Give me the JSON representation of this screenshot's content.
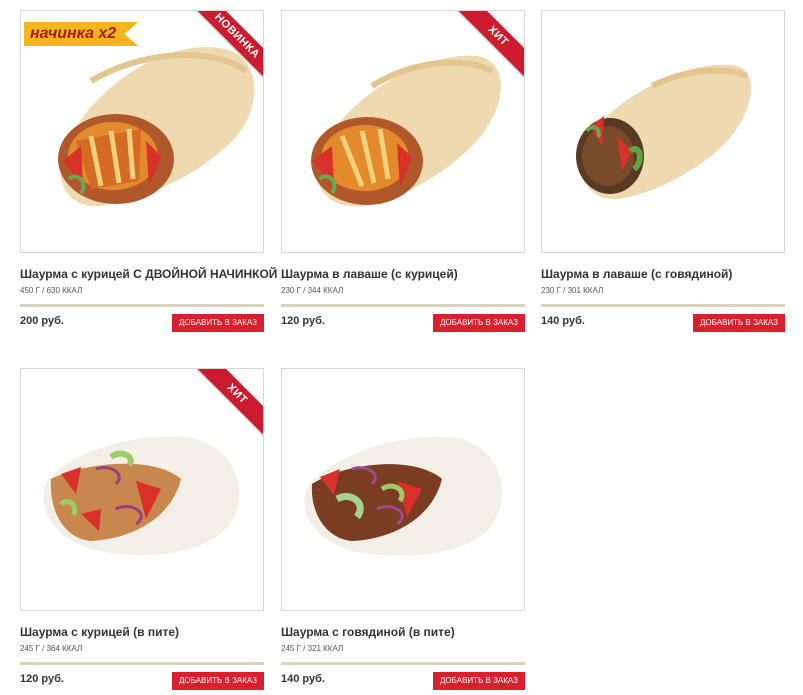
{
  "products": [
    {
      "title": "Шаурма с курицей С ДВОЙНОЙ НАЧИНКОЙ",
      "meta": "450 Г / 630 ККАЛ",
      "price": "200 руб.",
      "button": "ДОБАВИТЬ В ЗАКАЗ",
      "ribbon": "НОВИНКА",
      "promo": "начинка x2"
    },
    {
      "title": "Шаурма в лаваше (с курицей)",
      "meta": "230 Г / 344 ККАЛ",
      "price": "120 руб.",
      "button": "ДОБАВИТЬ В ЗАКАЗ",
      "ribbon": "ХИТ"
    },
    {
      "title": "Шаурма в лаваше (с говядиной)",
      "meta": "230 Г / 301 ККАЛ",
      "price": "140 руб.",
      "button": "ДОБАВИТЬ В ЗАКАЗ"
    },
    {
      "title": "Шаурма с курицей (в пите)",
      "meta": "245 Г / 364 ККАЛ",
      "price": "120 руб.",
      "button": "ДОБАВИТЬ В ЗАКАЗ",
      "ribbon": "ХИТ"
    },
    {
      "title": "Шаурма с говядиной (в пите)",
      "meta": "245 Г / 321 ККАЛ",
      "price": "140 руб.",
      "button": "ДОБАВИТЬ В ЗАКАЗ"
    }
  ],
  "colors": {
    "ribbon": "#cc1a2e",
    "button": "#d8202f",
    "promo_bg": "#f5b51c",
    "divider": "#d9d2bd"
  }
}
